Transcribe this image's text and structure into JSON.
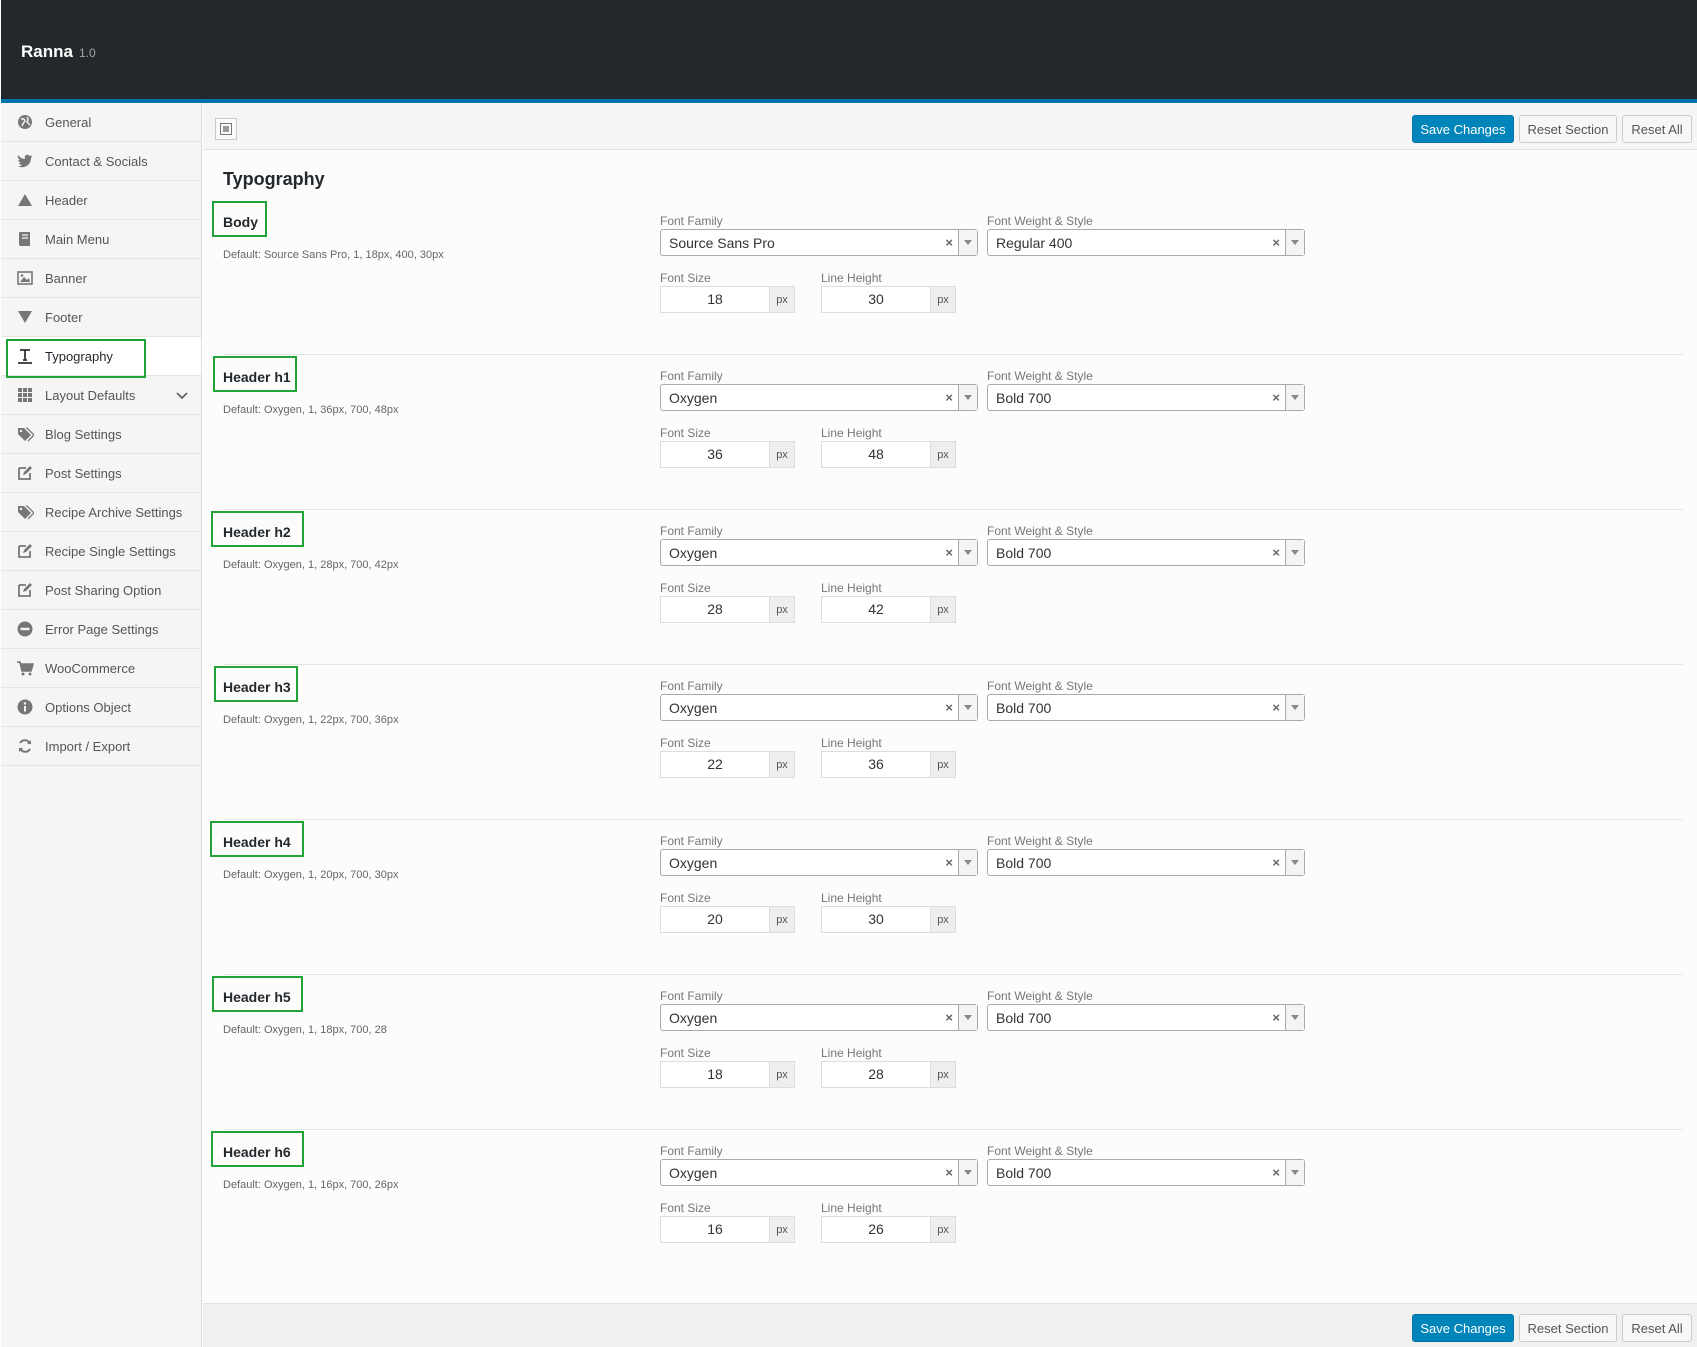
{
  "app": {
    "name": "Ranna",
    "version": "1.0"
  },
  "sidebar": {
    "items": [
      {
        "label": "General",
        "icon": "globe-icon"
      },
      {
        "label": "Contact & Socials",
        "icon": "twitter-icon"
      },
      {
        "label": "Header",
        "icon": "triangle-up-icon"
      },
      {
        "label": "Main Menu",
        "icon": "book-icon"
      },
      {
        "label": "Banner",
        "icon": "image-icon"
      },
      {
        "label": "Footer",
        "icon": "triangle-down-icon"
      },
      {
        "label": "Typography",
        "icon": "text-icon"
      },
      {
        "label": "Layout Defaults",
        "icon": "grid-icon"
      },
      {
        "label": "Blog Settings",
        "icon": "tags-icon"
      },
      {
        "label": "Post Settings",
        "icon": "edit-icon"
      },
      {
        "label": "Recipe Archive Settings",
        "icon": "tags-icon"
      },
      {
        "label": "Recipe Single Settings",
        "icon": "edit-icon"
      },
      {
        "label": "Post Sharing Option",
        "icon": "edit-icon"
      },
      {
        "label": "Error Page Settings",
        "icon": "minus-circle-icon"
      },
      {
        "label": "WooCommerce",
        "icon": "cart-icon"
      },
      {
        "label": "Options Object",
        "icon": "info-icon"
      },
      {
        "label": "Import / Export",
        "icon": "refresh-icon"
      }
    ],
    "active": "Typography"
  },
  "toolbar": {
    "save_label": "Save Changes",
    "reset_section_label": "Reset Section",
    "reset_all_label": "Reset All"
  },
  "section": {
    "title": "Typography"
  },
  "labels": {
    "font_family": "Font Family",
    "font_weight": "Font Weight & Style",
    "font_size": "Font Size",
    "line_height": "Line Height",
    "unit": "px",
    "clear": "×"
  },
  "fields": [
    {
      "title": "Body",
      "default": "Default: Source Sans Pro, 1, 18px, 400, 30px",
      "font_family": "Source Sans Pro",
      "font_weight": "Regular 400",
      "font_size": "18",
      "line_height": "30"
    },
    {
      "title": "Header h1",
      "default": "Default: Oxygen, 1, 36px, 700, 48px",
      "font_family": "Oxygen",
      "font_weight": "Bold 700",
      "font_size": "36",
      "line_height": "48"
    },
    {
      "title": "Header h2",
      "default": "Default: Oxygen, 1, 28px, 700, 42px",
      "font_family": "Oxygen",
      "font_weight": "Bold 700",
      "font_size": "28",
      "line_height": "42"
    },
    {
      "title": "Header h3",
      "default": "Default: Oxygen, 1, 22px, 700, 36px",
      "font_family": "Oxygen",
      "font_weight": "Bold 700",
      "font_size": "22",
      "line_height": "36"
    },
    {
      "title": "Header h4",
      "default": "Default: Oxygen, 1, 20px, 700, 30px",
      "font_family": "Oxygen",
      "font_weight": "Bold 700",
      "font_size": "20",
      "line_height": "30"
    },
    {
      "title": "Header h5",
      "default": "Default: Oxygen, 1, 18px, 700, 28",
      "font_family": "Oxygen",
      "font_weight": "Bold 700",
      "font_size": "18",
      "line_height": "28"
    },
    {
      "title": "Header h6",
      "default": "Default: Oxygen, 1, 16px, 700, 26px",
      "font_family": "Oxygen",
      "font_weight": "Bold 700",
      "font_size": "16",
      "line_height": "26"
    }
  ],
  "colors": {
    "accent": "#0085ba",
    "highlight": "#21a337",
    "topbar": "#23282d"
  }
}
